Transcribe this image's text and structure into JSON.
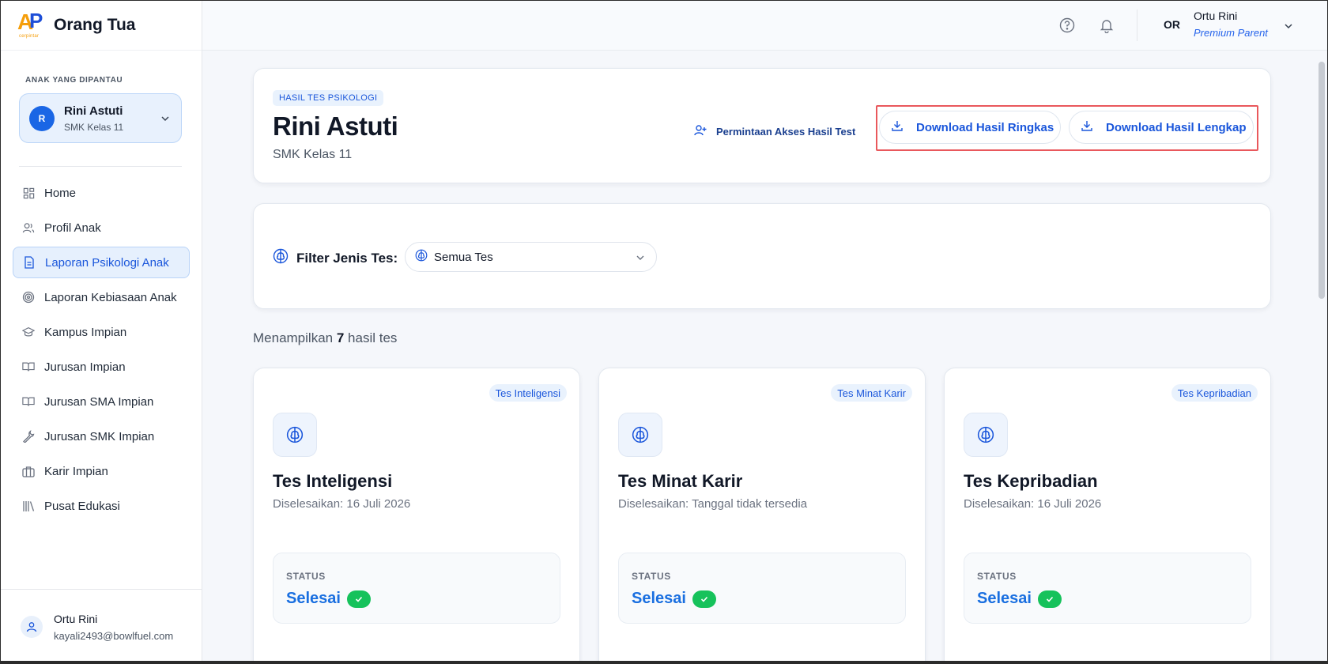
{
  "brand": {
    "name": "Orang Tua",
    "logo_sub": "cerpintar"
  },
  "sidebar": {
    "child_label": "ANAK YANG DIPANTAU",
    "child": {
      "initial": "R",
      "name": "Rini Astuti",
      "class": "SMK Kelas 11"
    },
    "items": [
      {
        "label": "Home",
        "icon": "grid-icon"
      },
      {
        "label": "Profil Anak",
        "icon": "users-icon"
      },
      {
        "label": "Laporan Psikologi Anak",
        "icon": "document-icon",
        "active": true
      },
      {
        "label": "Laporan Kebiasaan Anak",
        "icon": "target-icon"
      },
      {
        "label": "Kampus Impian",
        "icon": "graduation-cap-icon"
      },
      {
        "label": "Jurusan Impian",
        "icon": "book-icon"
      },
      {
        "label": "Jurusan SMA Impian",
        "icon": "book-icon"
      },
      {
        "label": "Jurusan SMK Impian",
        "icon": "wrench-icon"
      },
      {
        "label": "Karir Impian",
        "icon": "briefcase-icon"
      },
      {
        "label": "Pusat Edukasi",
        "icon": "library-icon"
      }
    ],
    "footer": {
      "name": "Ortu Rini",
      "email": "kayali2493@bowlfuel.com"
    }
  },
  "topbar": {
    "user_initials": "OR",
    "user_name": "Ortu Rini",
    "user_role": "Premium Parent"
  },
  "header": {
    "tag": "HASIL TES PSIKOLOGI",
    "name": "Rini Astuti",
    "class": "SMK Kelas 11",
    "request_label": "Permintaan Akses Hasil Test",
    "download_summary": "Download Hasil Ringkas",
    "download_full": "Download Hasil Lengkap"
  },
  "filter": {
    "label": "Filter Jenis Tes:",
    "selected": "Semua Tes"
  },
  "results": {
    "prefix": "Menampilkan",
    "count": "7",
    "suffix": "hasil tes"
  },
  "tests": [
    {
      "badge": "Tes Inteligensi",
      "title": "Tes Inteligensi",
      "date": "Diselesaikan: 16 Juli 2026",
      "status_label": "STATUS",
      "status": "Selesai"
    },
    {
      "badge": "Tes Minat Karir",
      "title": "Tes Minat Karir",
      "date": "Diselesaikan: Tanggal tidak tersedia",
      "status_label": "STATUS",
      "status": "Selesai"
    },
    {
      "badge": "Tes Kepribadian",
      "title": "Tes Kepribadian",
      "date": "Diselesaikan: 16 Juli 2026",
      "status_label": "STATUS",
      "status": "Selesai"
    }
  ],
  "colors": {
    "accent": "#1a56db",
    "success": "#16c25b",
    "highlight": "#e9585c"
  }
}
